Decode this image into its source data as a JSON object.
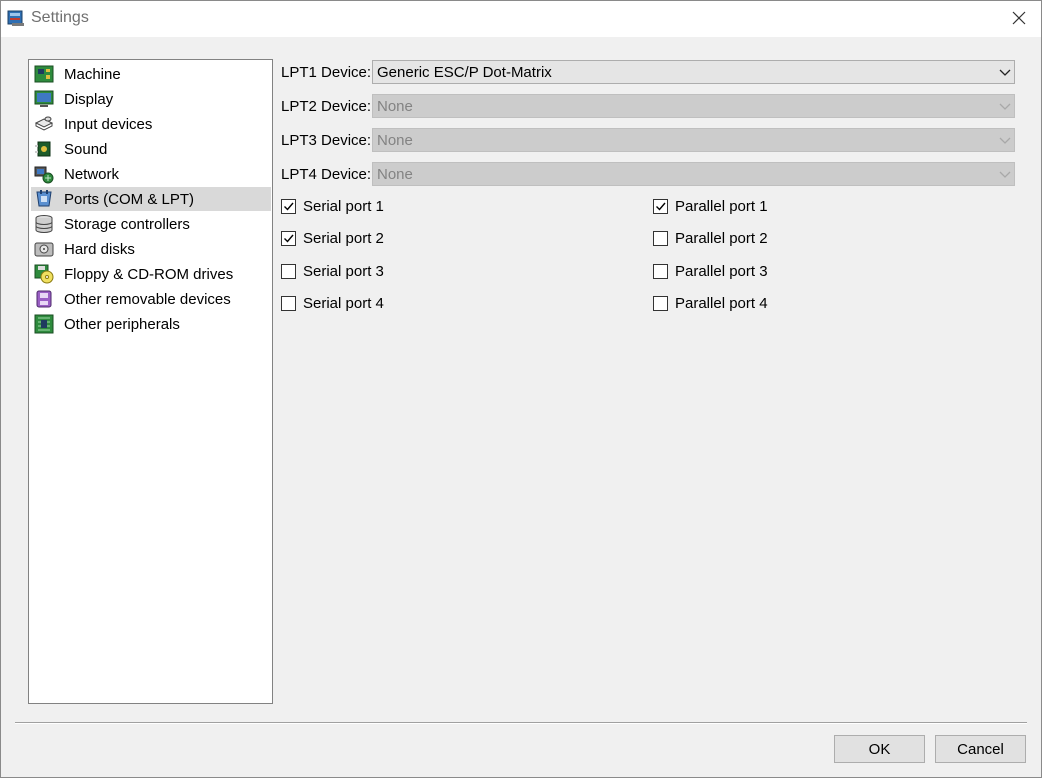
{
  "window": {
    "title": "Settings"
  },
  "categories": [
    {
      "label": "Machine",
      "icon": "machine-icon"
    },
    {
      "label": "Display",
      "icon": "display-icon"
    },
    {
      "label": "Input devices",
      "icon": "input-devices-icon"
    },
    {
      "label": "Sound",
      "icon": "sound-icon"
    },
    {
      "label": "Network",
      "icon": "network-icon"
    },
    {
      "label": "Ports (COM & LPT)",
      "icon": "ports-icon",
      "selected": true
    },
    {
      "label": "Storage controllers",
      "icon": "storage-controllers-icon"
    },
    {
      "label": "Hard disks",
      "icon": "hard-disks-icon"
    },
    {
      "label": "Floppy & CD-ROM drives",
      "icon": "floppy-cdrom-icon"
    },
    {
      "label": "Other removable devices",
      "icon": "removable-devices-icon"
    },
    {
      "label": "Other peripherals",
      "icon": "peripherals-icon"
    }
  ],
  "lpt": [
    {
      "label": "LPT1 Device:",
      "value": "Generic ESC/P Dot-Matrix",
      "enabled": true
    },
    {
      "label": "LPT2 Device:",
      "value": "None",
      "enabled": false
    },
    {
      "label": "LPT3 Device:",
      "value": "None",
      "enabled": false
    },
    {
      "label": "LPT4 Device:",
      "value": "None",
      "enabled": false
    }
  ],
  "serial_ports": [
    {
      "label": "Serial port 1",
      "checked": true
    },
    {
      "label": "Serial port 2",
      "checked": true
    },
    {
      "label": "Serial port 3",
      "checked": false
    },
    {
      "label": "Serial port 4",
      "checked": false
    }
  ],
  "parallel_ports": [
    {
      "label": "Parallel port 1",
      "checked": true
    },
    {
      "label": "Parallel port 2",
      "checked": false
    },
    {
      "label": "Parallel port 3",
      "checked": false
    },
    {
      "label": "Parallel port 4",
      "checked": false
    }
  ],
  "buttons": {
    "ok": "OK",
    "cancel": "Cancel"
  },
  "colors": {
    "selected_row": "#d9d9d9",
    "check_mark": "#000000"
  }
}
